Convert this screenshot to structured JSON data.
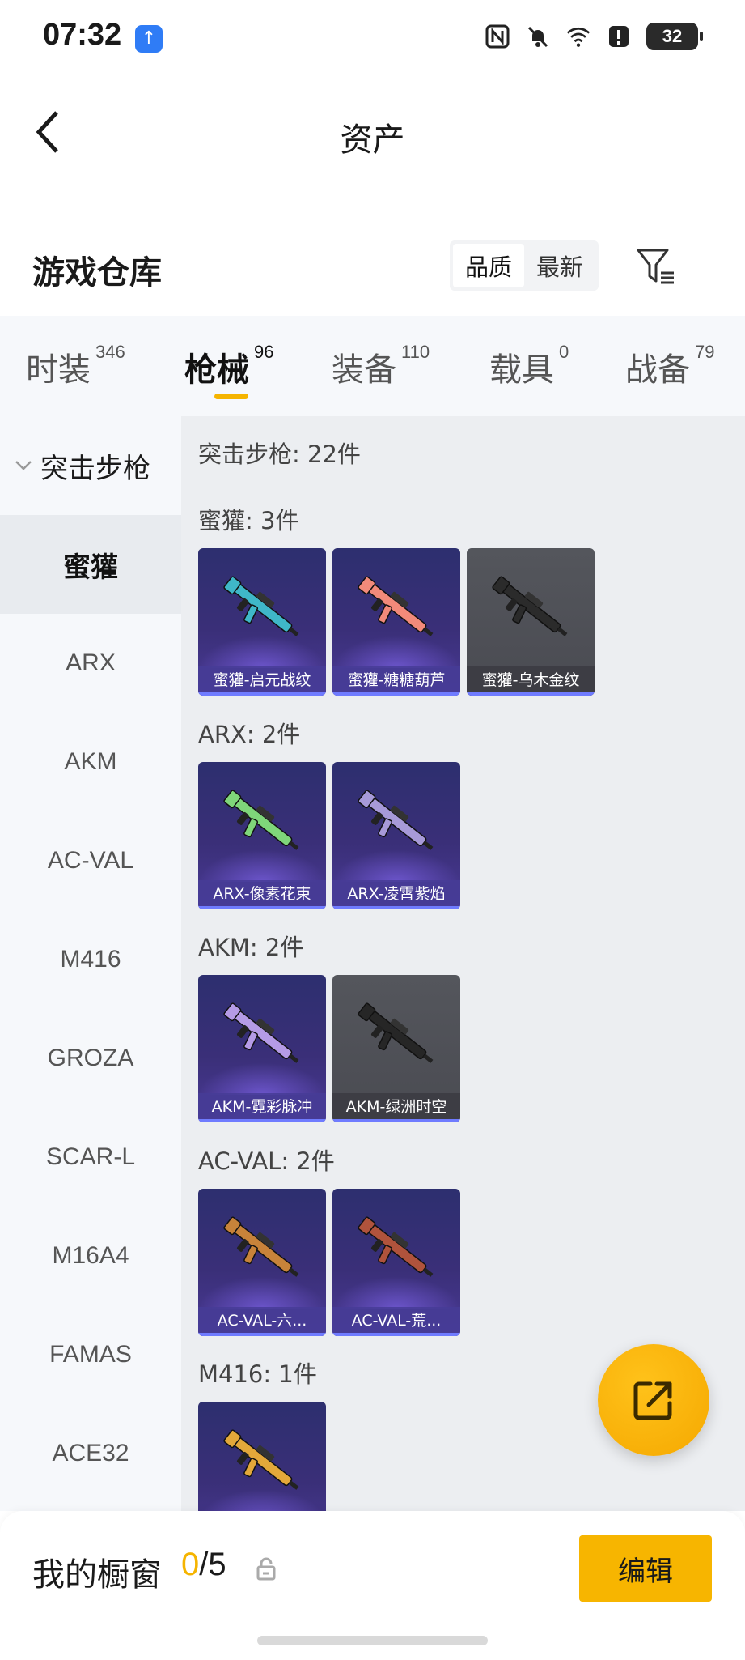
{
  "status_bar": {
    "time": "07:32",
    "upload_badge": "↑",
    "battery": "32",
    "icons": [
      "nfc-icon",
      "bell-off-icon",
      "wifi-icon",
      "alert-icon",
      "battery-icon"
    ]
  },
  "nav": {
    "title": "资产"
  },
  "warehouse": {
    "title": "游戏仓库",
    "sort_options": [
      "品质",
      "最新"
    ],
    "sort_selected": "品质"
  },
  "tabs": [
    {
      "label": "时装",
      "count": "346"
    },
    {
      "label": "枪械",
      "count": "96"
    },
    {
      "label": "装备",
      "count": "110"
    },
    {
      "label": "载具",
      "count": "0"
    },
    {
      "label": "战备",
      "count": "79"
    }
  ],
  "active_tab": "枪械",
  "sidebar": {
    "group": "突击步枪",
    "items": [
      "蜜獾",
      "ARX",
      "AKM",
      "AC-VAL",
      "M416",
      "GROZA",
      "SCAR-L",
      "M16A4",
      "FAMAS",
      "ACE32"
    ],
    "selected": "蜜獾"
  },
  "content": {
    "total": "突击步枪: 22件",
    "sections": [
      {
        "title": "蜜獾: 3件",
        "cards": [
          {
            "label": "蜜獾-启元战纹",
            "style": "purple",
            "color": "#3fb7c8"
          },
          {
            "label": "蜜獾-糖糖葫芦",
            "style": "purple",
            "color": "#f28a7a"
          },
          {
            "label": "蜜獾-乌木金纹",
            "style": "grey",
            "color": "#2b2b2b"
          }
        ]
      },
      {
        "title": "ARX: 2件",
        "cards": [
          {
            "label": "ARX-像素花束",
            "style": "purple",
            "color": "#7fd67a"
          },
          {
            "label": "ARX-凌霄紫焰",
            "style": "purple",
            "color": "#a79ad8"
          }
        ]
      },
      {
        "title": "AKM: 2件",
        "cards": [
          {
            "label": "AKM-霓彩脉冲",
            "style": "purple",
            "color": "#b59be6"
          },
          {
            "label": "AKM-绿洲时空",
            "style": "grey",
            "color": "#262626"
          }
        ]
      },
      {
        "title": "AC-VAL: 2件",
        "cards": [
          {
            "label": "AC-VAL-六...",
            "style": "purple",
            "color": "#c7833a"
          },
          {
            "label": "AC-VAL-荒...",
            "style": "purple",
            "color": "#b0533c"
          }
        ]
      },
      {
        "title": "M416: 1件",
        "cards": [
          {
            "label": "",
            "style": "purple",
            "color": "#e3a83a"
          }
        ]
      }
    ]
  },
  "bottom": {
    "showcase_label": "我的橱窗",
    "showcase_current": "0",
    "showcase_separator": "/",
    "showcase_max": "5",
    "edit_label": "编辑"
  }
}
